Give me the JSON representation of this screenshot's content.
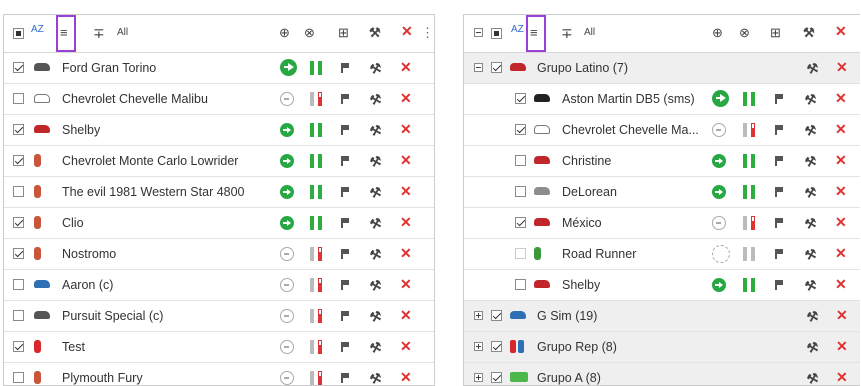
{
  "left": {
    "toolbar": {
      "sort_label": "AZ",
      "collapse_label": "≡",
      "expand_label": "∓",
      "all_label": "All",
      "xlabel": "✕",
      "more_label": "⋮"
    },
    "rows": [
      {
        "checked": true,
        "label": "Ford Gran Torino",
        "icon": "car-gray",
        "status": "big-green",
        "bars": "green"
      },
      {
        "checked": false,
        "label": "Chevrolet Chevelle Malibu",
        "icon": "car-outline",
        "status": "gray",
        "bars": "red"
      },
      {
        "checked": true,
        "label": "Shelby",
        "icon": "car-red",
        "status": "green",
        "bars": "green"
      },
      {
        "checked": true,
        "label": "Chevrolet Monte Carlo Lowrider",
        "icon": "person-red",
        "status": "green",
        "bars": "green"
      },
      {
        "checked": false,
        "label": "The evil 1981 Western Star 4800",
        "icon": "person-red",
        "status": "green",
        "bars": "green"
      },
      {
        "checked": true,
        "label": "Clio",
        "icon": "person-red",
        "status": "green",
        "bars": "green"
      },
      {
        "checked": true,
        "label": "Nostromo",
        "icon": "person-red",
        "status": "gray",
        "bars": "red"
      },
      {
        "checked": false,
        "label": "Aaron (c)",
        "icon": "car-blue",
        "status": "gray",
        "bars": "red"
      },
      {
        "checked": false,
        "label": "Pursuit Special (c)",
        "icon": "car-gray",
        "status": "gray",
        "bars": "red"
      },
      {
        "checked": true,
        "label": "Test",
        "icon": "person-redfill",
        "status": "gray",
        "bars": "red"
      },
      {
        "checked": false,
        "label": "Plymouth Fury",
        "icon": "person-red",
        "status": "gray",
        "bars": "red"
      }
    ]
  },
  "right": {
    "toolbar": {
      "sort_label": "AZ",
      "collapse_label": "≡",
      "expand_label": "∓",
      "all_label": "All",
      "xlabel": "✕"
    },
    "rows": [
      {
        "type": "group",
        "expanded": true,
        "checked": true,
        "label": "Grupo Latino (7)",
        "icon": "car-red"
      },
      {
        "type": "sub",
        "checked": true,
        "label": "Aston Martin DB5 (sms)",
        "icon": "car-black",
        "status": "big-green",
        "bars": "green"
      },
      {
        "type": "sub",
        "checked": true,
        "label": "Chevrolet Chevelle Ma...",
        "icon": "car-outline",
        "status": "gray",
        "bars": "red"
      },
      {
        "type": "sub",
        "checked": false,
        "label": "Christine",
        "icon": "car-red",
        "status": "green",
        "bars": "green"
      },
      {
        "type": "sub",
        "checked": false,
        "label": "DeLorean",
        "icon": "car-silver",
        "status": "green",
        "bars": "green"
      },
      {
        "type": "sub",
        "checked": true,
        "label": "México",
        "icon": "car-red",
        "status": "gray",
        "bars": "red"
      },
      {
        "type": "sub",
        "checked": false,
        "disabled": true,
        "label": "Road Runner",
        "icon": "person-green",
        "status": "dash",
        "bars": "gray"
      },
      {
        "type": "sub",
        "checked": false,
        "label": "Shelby",
        "icon": "car-red",
        "status": "green",
        "bars": "green"
      },
      {
        "type": "group",
        "expanded": false,
        "checked": true,
        "label": "G Sim (19)",
        "icon": "car-blue"
      },
      {
        "type": "group",
        "expanded": false,
        "checked": true,
        "label": "Grupo Rep (8)",
        "icon": "duo"
      },
      {
        "type": "group",
        "expanded": false,
        "checked": true,
        "label": "Grupo A (8)",
        "icon": "truck-green"
      }
    ]
  },
  "colors": {
    "accent_highlight": "#9b3fd9",
    "green": "#27a844",
    "red": "#e03030",
    "group_bg": "#efefef"
  }
}
